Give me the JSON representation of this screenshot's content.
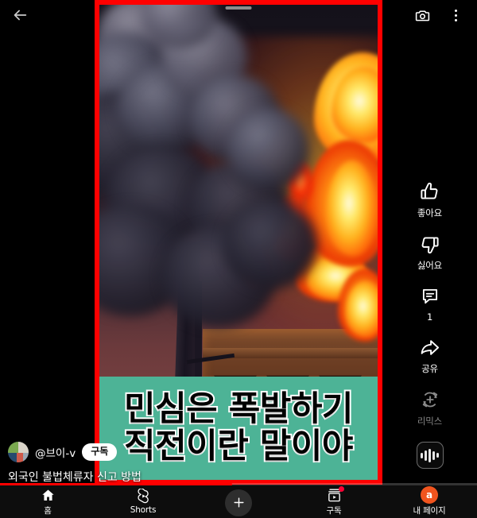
{
  "app": {
    "name": "YouTube Shorts",
    "background_color": "#000000",
    "accent_color": "#ff0000"
  },
  "topbar": {
    "back_icon": "back-arrow-icon",
    "camera_icon": "camera-icon",
    "overflow_icon": "more-vertical-icon"
  },
  "video": {
    "border_color": "#ff0000",
    "drag_handle": "drag-handle",
    "scene_description": "burning building with thick dark smoke and large orange flames",
    "caption": {
      "background_color": "#4db396",
      "text_color": "#000000",
      "outline_color": "#ffffff",
      "line1": "민심은 폭발하기",
      "line2": "직전이란 말이야"
    }
  },
  "actions": [
    {
      "name": "like",
      "icon": "thumbs-up-icon",
      "label": "좋아요",
      "dim": false
    },
    {
      "name": "dislike",
      "icon": "thumbs-down-icon",
      "label": "싫어요",
      "dim": false
    },
    {
      "name": "comment",
      "icon": "comment-icon",
      "label": "1",
      "dim": false
    },
    {
      "name": "share",
      "icon": "share-arrow-icon",
      "label": "공유",
      "dim": false
    },
    {
      "name": "remix",
      "icon": "remix-icon",
      "label": "리믹스",
      "dim": true
    }
  ],
  "sound_button": {
    "icon": "audio-waveform-icon",
    "label": ""
  },
  "meta": {
    "channel_handle": "@브이-v",
    "subscribe_label": "구독",
    "video_title": "외국인 불법체류자 신고 방법",
    "avatar": "channel-avatar"
  },
  "progress": {
    "percent": 48,
    "fill_color": "#ff0000",
    "track_color": "rgba(255,255,255,0.20)"
  },
  "bottom_nav": [
    {
      "name": "home",
      "icon": "home-icon",
      "label": "홈",
      "badge": false,
      "avatar": null
    },
    {
      "name": "shorts",
      "icon": "shorts-icon",
      "label": "Shorts",
      "badge": false,
      "avatar": null
    },
    {
      "name": "create",
      "icon": "plus-icon",
      "label": "",
      "badge": false,
      "avatar": null
    },
    {
      "name": "subscriptions",
      "icon": "subscriptions-icon",
      "label": "구독",
      "badge": true,
      "avatar": null
    },
    {
      "name": "my-page",
      "icon": "account-avatar",
      "label": "내 페이지",
      "badge": false,
      "avatar": "a"
    }
  ]
}
